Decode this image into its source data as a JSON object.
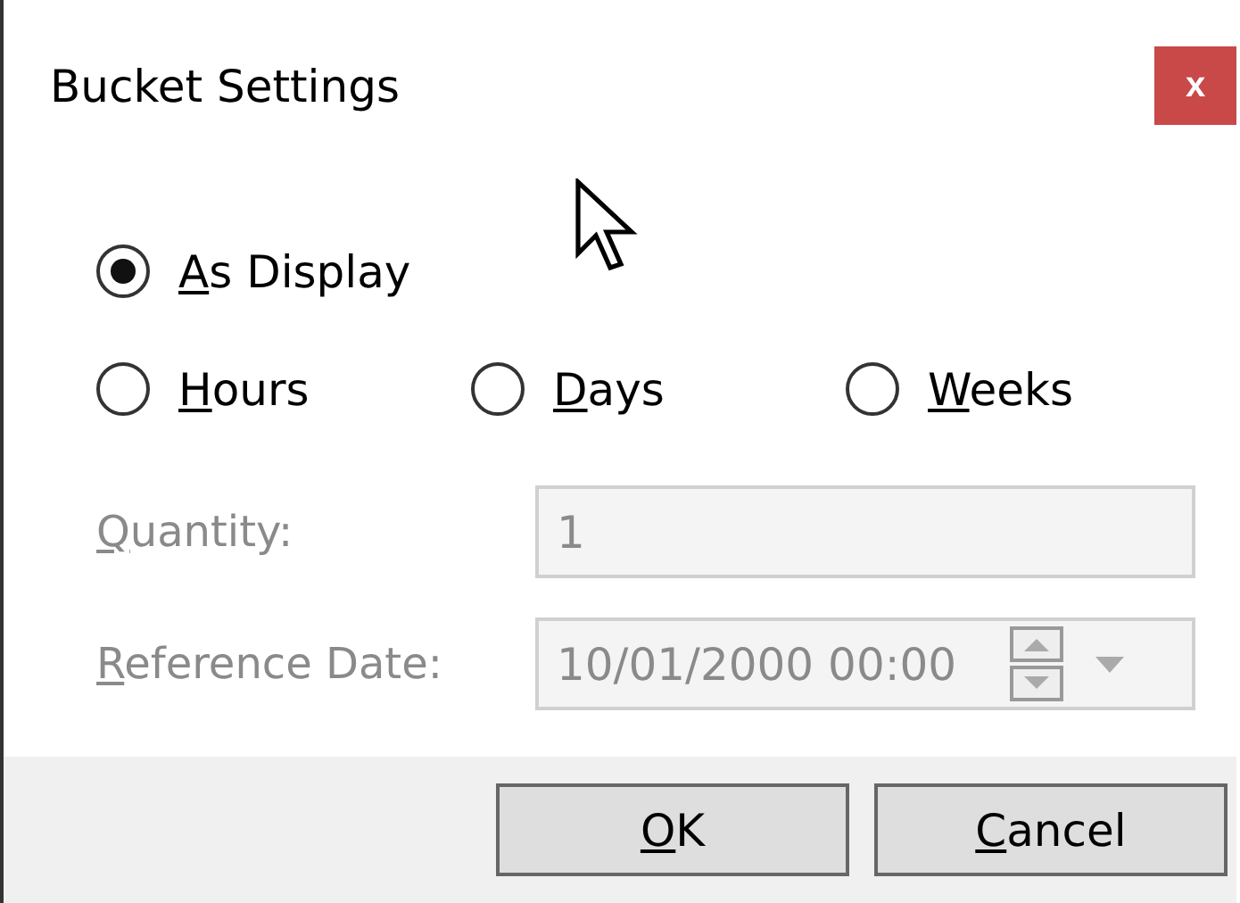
{
  "window": {
    "title": "Bucket Settings",
    "close": "x"
  },
  "option_rows": [
    [
      {
        "access_key": "A",
        "rest": "s Display",
        "selected": true
      }
    ],
    [
      {
        "access_key": "H",
        "rest": "ours",
        "selected": false
      },
      {
        "access_key": "D",
        "rest": "ays",
        "selected": false
      },
      {
        "access_key": "W",
        "rest": "eeks",
        "selected": false
      }
    ]
  ],
  "fields": [
    {
      "kind": "text",
      "access_key": "Q",
      "rest": "uantity:",
      "value": "1",
      "disabled": true
    },
    {
      "kind": "datetime",
      "access_key": "R",
      "rest": "eference Date:",
      "value": "10/01/2000 00:00",
      "disabled": true
    }
  ],
  "buttons": [
    {
      "access_key": "O",
      "rest": "K"
    },
    {
      "access_key": "C",
      "rest": "ancel"
    }
  ]
}
